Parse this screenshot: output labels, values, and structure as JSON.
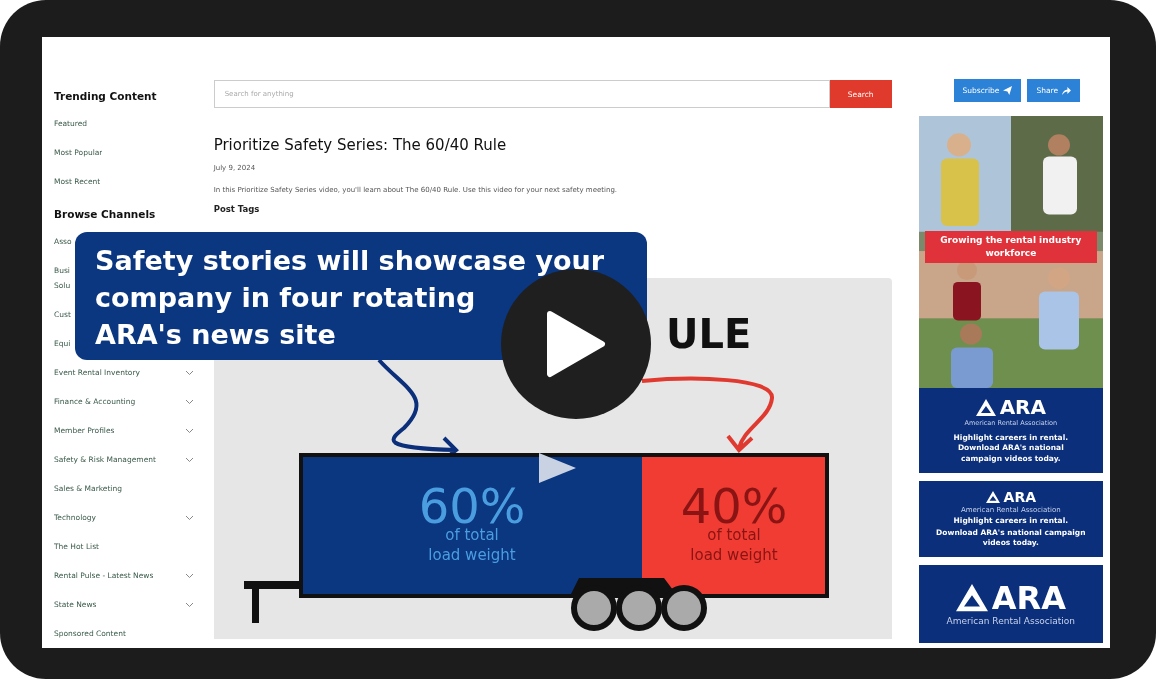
{
  "sidebar": {
    "sections": [
      {
        "title": "Trending Content",
        "items": [
          {
            "label": "Featured",
            "expandable": false
          },
          {
            "label": "Most Popular",
            "expandable": false
          },
          {
            "label": "Most Recent",
            "expandable": false
          }
        ]
      },
      {
        "title": "Browse Channels",
        "items": [
          {
            "label": "Asso"
          },
          {
            "label": "Busi Solu"
          },
          {
            "label": "Cust"
          },
          {
            "label": "Equi"
          },
          {
            "label": "Event Rental Inventory",
            "expandable": true
          },
          {
            "label": "Finance & Accounting",
            "expandable": true
          },
          {
            "label": "Member Profiles",
            "expandable": true
          },
          {
            "label": "Safety & Risk Management",
            "expandable": true
          },
          {
            "label": "Sales & Marketing",
            "expandable": false
          },
          {
            "label": "Technology",
            "expandable": true
          },
          {
            "label": "The Hot List",
            "expandable": false
          },
          {
            "label": "Rental Pulse - Latest News",
            "expandable": true
          },
          {
            "label": "State News",
            "expandable": true
          },
          {
            "label": "Sponsored Content",
            "expandable": false
          }
        ]
      }
    ]
  },
  "search": {
    "placeholder": "Search for anything",
    "button": "Search"
  },
  "post": {
    "title": "Prioritize Safety Series: The 60/40 Rule",
    "date": "July 9, 2024",
    "description": "In this Prioritize Safety Series video, you'll learn about The 60/40 Rule. Use this video for your next safety meeting.",
    "tags_heading": "Post Tags"
  },
  "video": {
    "heading": "ULE",
    "front": {
      "percent": "60%",
      "caption": [
        "of total",
        "load weight"
      ]
    },
    "back": {
      "percent": "40%",
      "caption": [
        "of total",
        "load weight"
      ]
    }
  },
  "callout": {
    "lines": [
      "Safety stories will showcase your",
      "company in four rotating",
      "ARA's news site"
    ]
  },
  "actions": [
    {
      "label": "Subscribe"
    },
    {
      "label": "Share"
    }
  ],
  "ads": [
    {
      "banner": "Growing the rental industry workforce"
    },
    {
      "kind": "promo",
      "logo": "ARA",
      "org": "American Rental Association",
      "text": "Highlight careers in rental. Download ARA's national campaign videos today."
    },
    {
      "kind": "strip",
      "logo": "ARA",
      "org": "American Rental Association",
      "lines": [
        "Highlight careers in rental.",
        "Download ARA's national campaign videos today."
      ]
    },
    {
      "kind": "logo",
      "logo": "ARA",
      "org": "American Rental Association"
    }
  ]
}
